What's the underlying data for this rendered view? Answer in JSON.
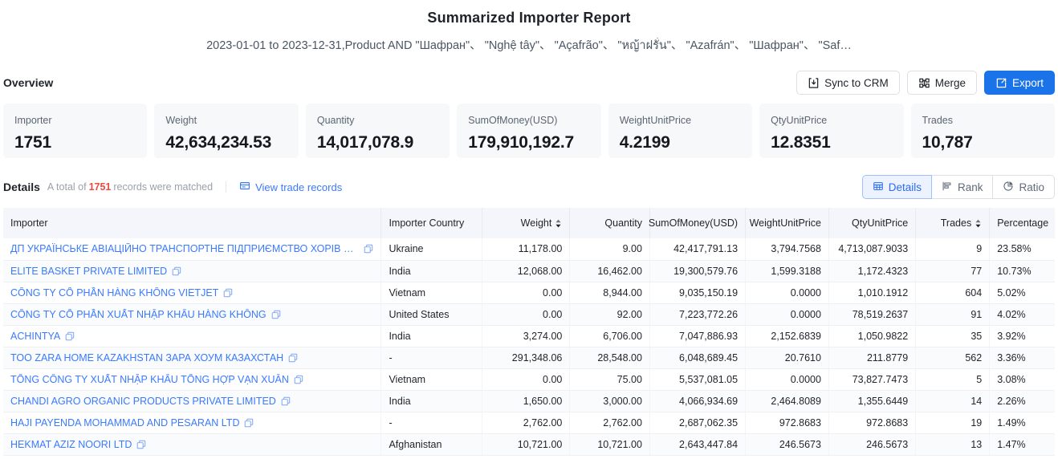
{
  "header": {
    "title": "Summarized Importer Report",
    "subtitle": "2023-01-01 to 2023-12-31,Product AND \"Шафран\"、 \"Nghệ tây\"、 \"Açafrão\"、 \"หญ้าฝรั่น\"、 \"Azafrán\"、 \"Шафран\"、 \"Saf…"
  },
  "overview": {
    "label": "Overview",
    "actions": [
      {
        "id": "sync-to-crm",
        "label": "Sync to CRM",
        "icon": "sync-icon",
        "primary": false
      },
      {
        "id": "merge",
        "label": "Merge",
        "icon": "merge-icon",
        "primary": false
      },
      {
        "id": "export",
        "label": "Export",
        "icon": "export-icon",
        "primary": true
      }
    ],
    "stats": [
      {
        "title": "Importer",
        "value": "1751"
      },
      {
        "title": "Weight",
        "value": "42,634,234.53"
      },
      {
        "title": "Quantity",
        "value": "14,017,078.9"
      },
      {
        "title": "SumOfMoney(USD)",
        "value": "179,910,192.7"
      },
      {
        "title": "WeightUnitPrice",
        "value": "4.2199"
      },
      {
        "title": "QtyUnitPrice",
        "value": "12.8351"
      },
      {
        "title": "Trades",
        "value": "10,787"
      }
    ]
  },
  "details": {
    "label": "Details",
    "meta_prefix": "A total of",
    "count": "1751",
    "meta_suffix": "records were matched",
    "view_records_label": "View trade records",
    "view_records_icon": "records-icon",
    "tabs": [
      {
        "id": "details",
        "label": "Details",
        "icon": "grid-icon",
        "active": true
      },
      {
        "id": "rank",
        "label": "Rank",
        "icon": "rank-icon",
        "active": false
      },
      {
        "id": "ratio",
        "label": "Ratio",
        "icon": "pie-icon",
        "active": false
      }
    ]
  },
  "table": {
    "columns": [
      {
        "key": "importer",
        "label": "Importer",
        "align": "left",
        "sortable": false
      },
      {
        "key": "country",
        "label": "Importer Country",
        "align": "left",
        "sortable": false
      },
      {
        "key": "weight",
        "label": "Weight",
        "align": "right",
        "sortable": true
      },
      {
        "key": "quantity",
        "label": "Quantity",
        "align": "right",
        "sortable": false
      },
      {
        "key": "summoney",
        "label": "SumOfMoney(USD)",
        "align": "right",
        "sortable": false
      },
      {
        "key": "wup",
        "label": "WeightUnitPrice",
        "align": "right",
        "sortable": false
      },
      {
        "key": "qup",
        "label": "QtyUnitPrice",
        "align": "right",
        "sortable": false
      },
      {
        "key": "trades",
        "label": "Trades",
        "align": "right",
        "sortable": true
      },
      {
        "key": "pct",
        "label": "Percentage",
        "align": "left",
        "sortable": false
      }
    ],
    "rows": [
      {
        "importer": "ДП УКРАЇНСЬКЕ АВІАЦІЙНО ТРАНСПОРТНЕ ПІДПРИЄМСТВО ХОРІВ АВІА",
        "country": "Ukraine",
        "weight": "11,178.00",
        "quantity": "9.00",
        "summoney": "42,417,791.13",
        "wup": "3,794.7568",
        "qup": "4,713,087.9033",
        "trades": "9",
        "pct": "23.58%"
      },
      {
        "importer": "ELITE BASKET PRIVATE LIMITED",
        "country": "India",
        "weight": "12,068.00",
        "quantity": "16,462.00",
        "summoney": "19,300,579.76",
        "wup": "1,599.3188",
        "qup": "1,172.4323",
        "trades": "77",
        "pct": "10.73%"
      },
      {
        "importer": "CÔNG TY CỔ PHẦN HÀNG KHÔNG VIETJET",
        "country": "Vietnam",
        "weight": "0.00",
        "quantity": "8,944.00",
        "summoney": "9,035,150.19",
        "wup": "0.0000",
        "qup": "1,010.1912",
        "trades": "604",
        "pct": "5.02%"
      },
      {
        "importer": "CÔNG TY CỔ PHẦN XUẤT NHẬP KHẨU HÀNG KHÔNG",
        "country": "United States",
        "weight": "0.00",
        "quantity": "92.00",
        "summoney": "7,223,772.26",
        "wup": "0.0000",
        "qup": "78,519.2637",
        "trades": "91",
        "pct": "4.02%"
      },
      {
        "importer": "ACHINTYA",
        "country": "India",
        "weight": "3,274.00",
        "quantity": "6,706.00",
        "summoney": "7,047,886.93",
        "wup": "2,152.6839",
        "qup": "1,050.9822",
        "trades": "35",
        "pct": "3.92%"
      },
      {
        "importer": "TOO ZARA HOME KAZAKHSTAN ЗАРА ХОУМ КАЗАХСТАН",
        "country": "-",
        "weight": "291,348.06",
        "quantity": "28,548.00",
        "summoney": "6,048,689.45",
        "wup": "20.7610",
        "qup": "211.8779",
        "trades": "562",
        "pct": "3.36%"
      },
      {
        "importer": "TỔNG CÔNG TY XUẤT NHẬP KHẨU TỔNG HỢP VẠN XUÂN",
        "country": "Vietnam",
        "weight": "0.00",
        "quantity": "75.00",
        "summoney": "5,537,081.05",
        "wup": "0.0000",
        "qup": "73,827.7473",
        "trades": "5",
        "pct": "3.08%"
      },
      {
        "importer": "CHANDI AGRO ORGANIC PRODUCTS PRIVATE LIMITED",
        "country": "India",
        "weight": "1,650.00",
        "quantity": "3,000.00",
        "summoney": "4,066,934.69",
        "wup": "2,464.8089",
        "qup": "1,355.6449",
        "trades": "14",
        "pct": "2.26%"
      },
      {
        "importer": "HAJI PAYENDA MOHAMMAD AND PESARAN LTD",
        "country": "-",
        "weight": "2,762.00",
        "quantity": "2,762.00",
        "summoney": "2,687,062.35",
        "wup": "972.8683",
        "qup": "972.8683",
        "trades": "19",
        "pct": "1.49%"
      },
      {
        "importer": "HEKMAT AZIZ NOORI LTD",
        "country": "Afghanistan",
        "weight": "10,721.00",
        "quantity": "10,721.00",
        "summoney": "2,643,447.84",
        "wup": "246.5673",
        "qup": "246.5673",
        "trades": "13",
        "pct": "1.47%"
      }
    ]
  },
  "colors": {
    "accent": "#1a73e8",
    "link": "#3a7afe",
    "count_red": "#f0483e",
    "header_bg": "#f4f6fb",
    "card_bg": "#f7f8fa"
  }
}
